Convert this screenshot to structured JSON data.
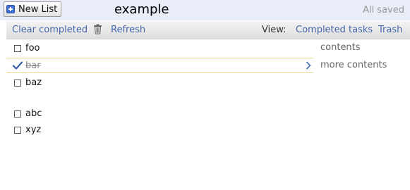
{
  "header": {
    "new_list_label": "New List",
    "title": "example",
    "status": "All saved"
  },
  "toolbar": {
    "clear_completed": "Clear completed",
    "refresh": "Refresh",
    "view_label": "View:",
    "completed_tasks": "Completed tasks",
    "trash": "Trash"
  },
  "tasks": [
    {
      "text": "foo",
      "completed": false
    },
    {
      "text": "bar",
      "completed": true,
      "selected": true
    },
    {
      "text": "baz",
      "completed": false
    },
    {
      "text": "",
      "completed": false
    },
    {
      "text": "abc",
      "completed": false
    },
    {
      "text": "xyz",
      "completed": false
    }
  ],
  "notes": {
    "line1": "contents",
    "line2": "more contents"
  },
  "colors": {
    "header_bg": "#e8edf8",
    "link": "#4666a8",
    "selected_border": "#e6d98a"
  }
}
